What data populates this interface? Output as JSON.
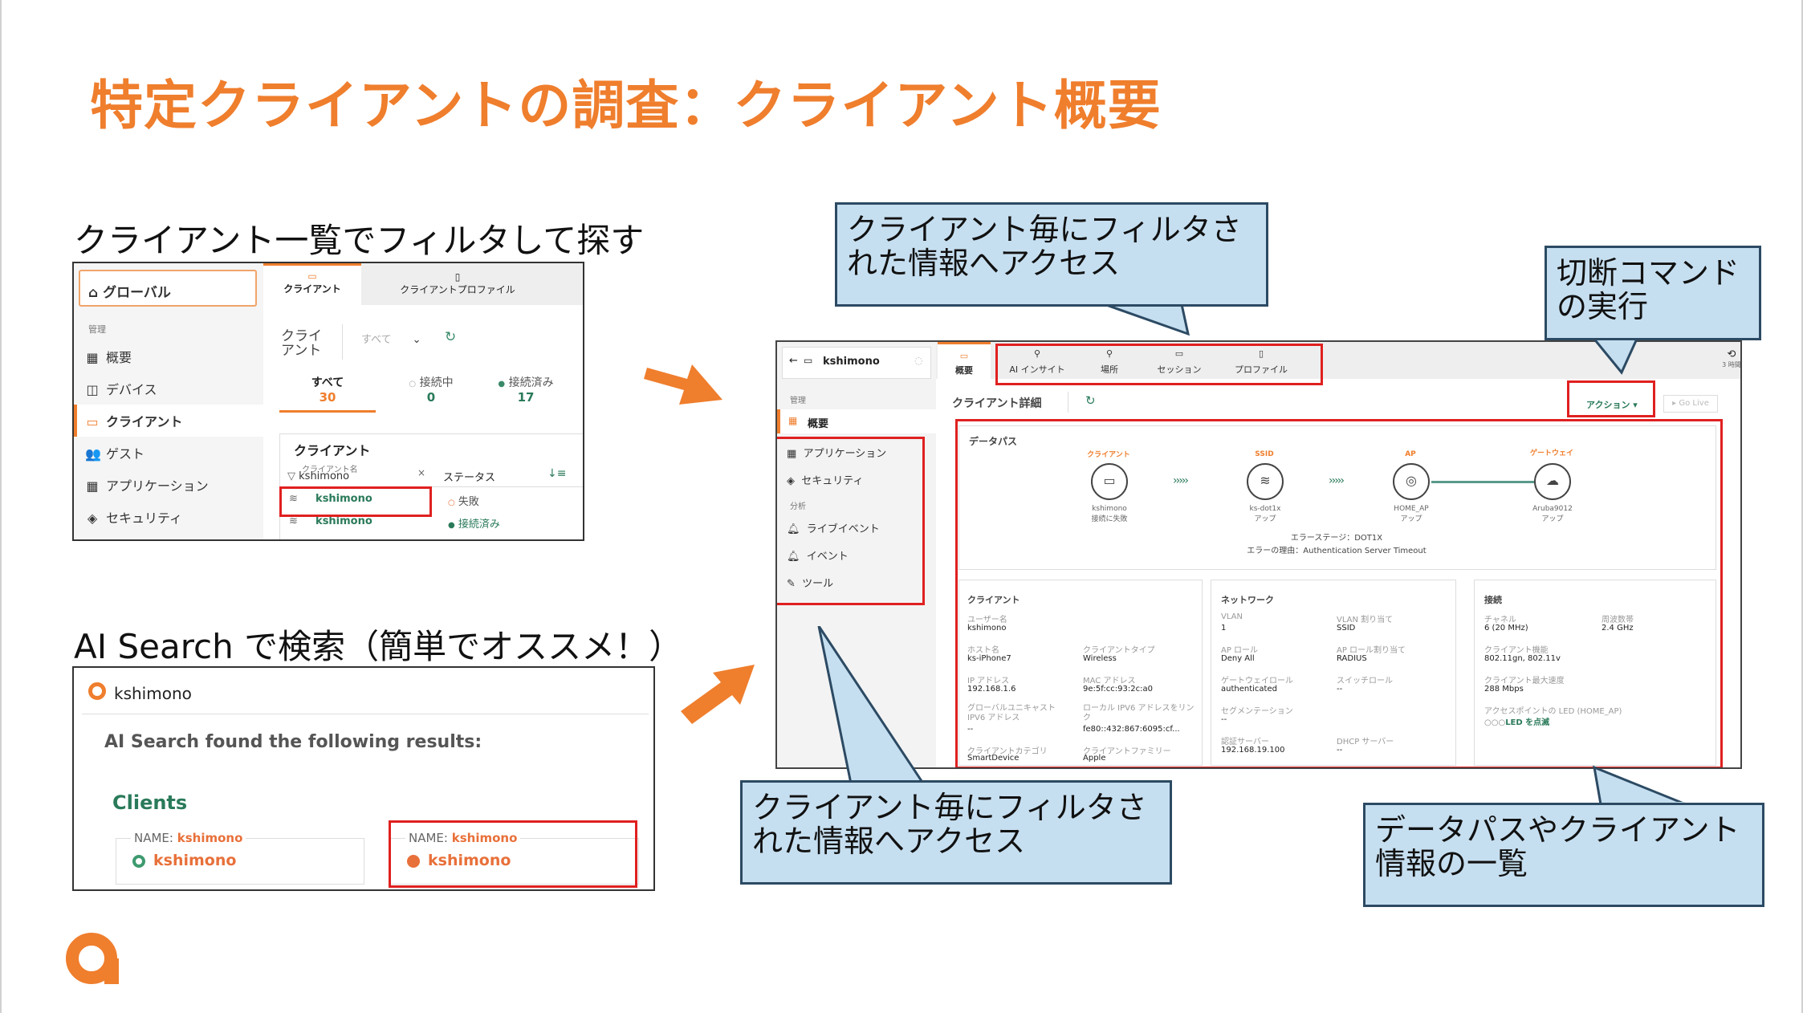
{
  "slide": {
    "title": "特定クライアントの調査：クライアント概要",
    "left_heading_1": "クライアント一覧でフィルタして探す",
    "left_heading_2": "AI Search で検索（簡単でオススメ！）"
  },
  "callouts": {
    "top": "クライアント毎にフィルタされた情報へアクセス",
    "disconnect": "切断コマンドの実行",
    "bottom": "クライアント毎にフィルタされた情報へアクセス",
    "datapath": "データパスやクライアント情報の一覧"
  },
  "client_list": {
    "global_label": "グローバル",
    "tab_client": "クライアント",
    "tab_client_profile": "クライアントプロファイル",
    "section_manage": "管理",
    "nav": [
      "概要",
      "デバイス",
      "クライアント",
      "ゲスト",
      "アプリケーション",
      "セキュリティ"
    ],
    "page_label": "クライアント",
    "filter_value": "すべて",
    "counters": [
      {
        "label": "すべて",
        "value": "30"
      },
      {
        "label": "接続中",
        "value": "0"
      },
      {
        "label": "接続済み",
        "value": "17"
      }
    ],
    "table_title": "クライアント",
    "col_name_label": "クライアント名",
    "col_name_filter": "kshimono",
    "col_status": "ステータス",
    "rows": [
      {
        "name": "kshimono",
        "status": "失敗"
      },
      {
        "name": "kshimono",
        "status": "接続済み"
      }
    ]
  },
  "ai_search": {
    "query": "kshimono",
    "found_text": "AI Search found the following results:",
    "section": "Clients",
    "name_prefix": "NAME:",
    "results": [
      {
        "name_value": "kshimono",
        "title": "kshimono",
        "status_color": "#3d9a6f"
      },
      {
        "name_value": "kshimono",
        "title": "kshimono",
        "status_color": "#e8703a"
      }
    ]
  },
  "detail": {
    "client_name": "kshimono",
    "section_manage": "管理",
    "nav_overview": "概要",
    "nav_items": [
      "アプリケーション",
      "セキュリティ"
    ],
    "section_analysis": "分析",
    "nav_analysis": [
      "ライブイベント",
      "イベント",
      "ツール"
    ],
    "tabs": [
      "概要",
      "AI インサイト",
      "場所",
      "セッション",
      "プロファイル"
    ],
    "history_label": "3 時間",
    "page_title": "クライアント詳細",
    "action_button": "アクション ▾",
    "golive_button": "Go Live",
    "datapath": {
      "title": "データパス",
      "nodes": [
        {
          "top": "クライアント",
          "name": "kshimono",
          "status": "接続に失敗"
        },
        {
          "top": "SSID",
          "name": "ks-dot1x",
          "status": "アップ"
        },
        {
          "top": "AP",
          "name": "HOME_AP",
          "status": "アップ"
        },
        {
          "top": "ゲートウェイ",
          "name": "Aruba9012",
          "status": "アップ"
        }
      ],
      "error_stage": "エラーステージ：DOT1X",
      "error_reason": "エラーの理由：Authentication Server Timeout"
    },
    "client_panel": {
      "title": "クライアント",
      "fields": [
        {
          "label": "ユーザー名",
          "value": "kshimono"
        },
        {
          "label": "ホスト名",
          "value": "ks-iPhone7"
        },
        {
          "label": "クライアントタイプ",
          "value": "Wireless"
        },
        {
          "label": "IP アドレス",
          "value": "192.168.1.6"
        },
        {
          "label": "MAC アドレス",
          "value": "9e:5f:cc:93:2c:a0"
        },
        {
          "label": "グローバルユニキャスト IPV6 アドレス",
          "value": "--"
        },
        {
          "label": "ローカル IPV6 アドレスをリンク",
          "value": "fe80::432:867:6095:cf..."
        },
        {
          "label": "クライアントカテゴリ",
          "value": "SmartDevice"
        },
        {
          "label": "クライアントファミリー",
          "value": "Apple"
        }
      ]
    },
    "network_panel": {
      "title": "ネットワーク",
      "fields": [
        {
          "label": "VLAN",
          "value": "1"
        },
        {
          "label": "VLAN 割り当て",
          "value": "SSID"
        },
        {
          "label": "AP ロール",
          "value": "Deny All"
        },
        {
          "label": "AP ロール割り当て",
          "value": "RADIUS"
        },
        {
          "label": "ゲートウェイロール",
          "value": "authenticated"
        },
        {
          "label": "スイッチロール",
          "value": "--"
        },
        {
          "label": "セグメンテーション",
          "value": "--"
        },
        {
          "label": "認証サーバー",
          "value": "192.168.19.100"
        },
        {
          "label": "DHCP サーバー",
          "value": "--"
        }
      ]
    },
    "connection_panel": {
      "title": "接続",
      "fields": [
        {
          "label": "チャネル",
          "value": "6 (20 MHz)"
        },
        {
          "label": "周波数帯",
          "value": "2.4 GHz"
        },
        {
          "label": "クライアント機能",
          "value": "802.11gn, 802.11v"
        },
        {
          "label": "クライアント最大速度",
          "value": "288 Mbps"
        },
        {
          "label": "アクセスポイントの LED (HOME_AP)",
          "value": "LED を点滅"
        }
      ]
    }
  },
  "colors": {
    "accent": "#ef7e2d",
    "callout_fill": "#c6dff0",
    "callout_border": "#2c4a63",
    "highlight": "#e02020"
  }
}
